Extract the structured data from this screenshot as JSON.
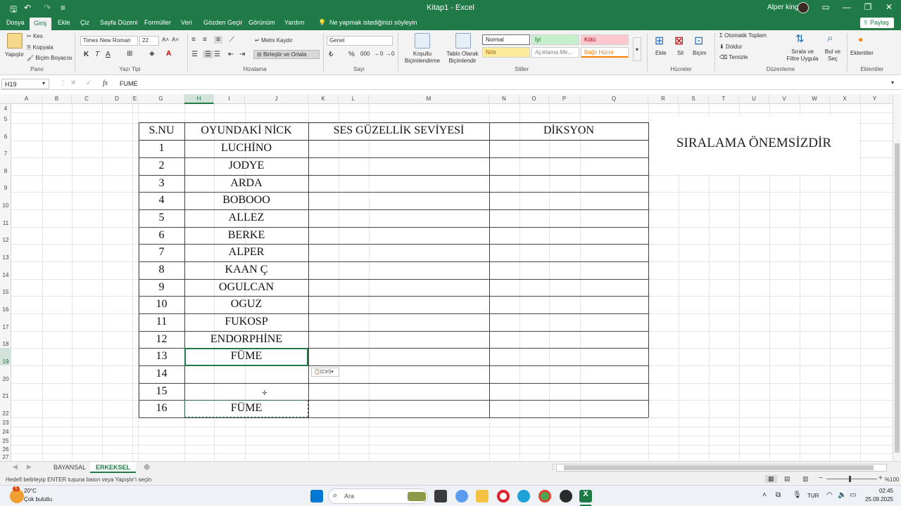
{
  "titlebar": {
    "title": "Kitap1 - Excel",
    "user": "Alper king"
  },
  "tabs": [
    "Dosya",
    "Giriş",
    "Ekle",
    "Çiz",
    "Sayfa Düzeni",
    "Formüller",
    "Veri",
    "Gözden Geçir",
    "Görünüm",
    "Yardım"
  ],
  "active_tab": "Giriş",
  "tell_me": "Ne yapmak istediğinizi söyleyin",
  "share_label": "Paylaş",
  "ribbon": {
    "clipboard": {
      "paste": "Yapıştır",
      "cut": "Kes",
      "copy": "Kopyala",
      "format_painter": "Biçim Boyacısı",
      "group": "Pano"
    },
    "font": {
      "name": "Times New Roman",
      "size": "22",
      "group": "Yazı Tipi"
    },
    "alignment": {
      "wrap": "Metni Kaydır",
      "merge": "Birleştir ve Ortala",
      "group": "Hizalama"
    },
    "number": {
      "format": "Genel",
      "group": "Sayı"
    },
    "styles": {
      "conditional": "Koşullu Biçimlendirme",
      "as_table": "Tablo Olarak Biçimlendir",
      "normal": "Normal",
      "good": "İyi",
      "bad": "Kötü",
      "neutral": "Nötr",
      "explanatory": "Açıklama Me...",
      "linked": "Bağlı Hücre",
      "group": "Stiller"
    },
    "cells": {
      "insert": "Ekle",
      "delete": "Sil",
      "format": "Biçim",
      "group": "Hücreler"
    },
    "editing": {
      "autosum": "Otomatik Toplam",
      "fill": "Doldur",
      "clear": "Temizle",
      "sort": "Sırala ve Filtre Uygula",
      "find": "Bul ve Seç",
      "group": "Düzenleme"
    },
    "addins": {
      "label": "Eklentiler",
      "group": "Eklentiler"
    }
  },
  "formula_bar": {
    "name_box": "H19",
    "fx": "fx",
    "content": "FUME"
  },
  "columns": [
    "A",
    "B",
    "C",
    "D",
    "E",
    "G",
    "H",
    "I",
    "J",
    "K",
    "L",
    "M",
    "N",
    "O",
    "P",
    "Q",
    "R",
    "S",
    "T",
    "U",
    "V",
    "W",
    "X",
    "Y"
  ],
  "rows": [
    "4",
    "5",
    "6",
    "7",
    "8",
    "9",
    "10",
    "11",
    "12",
    "13",
    "14",
    "15",
    "16",
    "17",
    "18",
    "19",
    "20",
    "21",
    "22",
    "23",
    "24",
    "25",
    "26",
    "27"
  ],
  "table": {
    "headers": [
      "S.NU",
      "OYUNDAKİ NİCK",
      "SES GÜZELLİK SEVİYESİ",
      "DİKSYON"
    ],
    "rows": [
      [
        "1",
        "LUCHİNO"
      ],
      [
        "2",
        "JODYE"
      ],
      [
        "3",
        "ARDA"
      ],
      [
        "4",
        "BOBOOO"
      ],
      [
        "5",
        "ALLEZ"
      ],
      [
        "6",
        "BERKE"
      ],
      [
        "7",
        "ALPER"
      ],
      [
        "8",
        "KAAN Ç"
      ],
      [
        "9",
        "OGULCAN"
      ],
      [
        "10",
        "OGUZ"
      ],
      [
        "11",
        "FUKOSP"
      ],
      [
        "12",
        "ENDORPHİNE"
      ],
      [
        "13",
        "FÜME"
      ],
      [
        "14",
        ""
      ],
      [
        "15",
        ""
      ],
      [
        "16",
        "FÜME"
      ]
    ]
  },
  "note": "SIRALAMA ÖNEMSİZDİR",
  "paste_options": "(Ctrl)",
  "sheets": [
    "BAYANSAL",
    "ERKEKSEL"
  ],
  "active_sheet": "ERKEKSEL",
  "status_text": "Hedefi belirleyip ENTER tuşuna basın veya Yapıştır'ı seçin",
  "zoom": "%100",
  "taskbar": {
    "weather_temp": "20°C",
    "weather_desc": "Çok bulutlu",
    "search": "Ara",
    "lang": "TUR",
    "time": "02:45",
    "date": "25.09.2025",
    "badge": "5"
  },
  "colors": {
    "accent": "#1f7a47",
    "good_bg": "#c6efce",
    "bad_bg": "#ffc7ce",
    "neutral_bg": "#ffeb9c"
  }
}
